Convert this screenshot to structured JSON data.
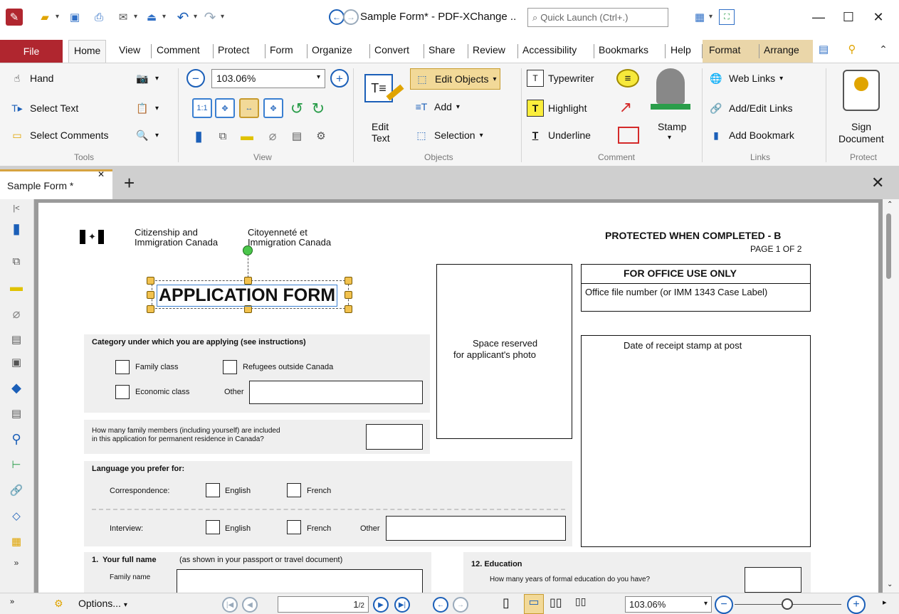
{
  "app": {
    "title": "Sample Form* - PDF-XChange ..",
    "quick_launch_placeholder": "Quick Launch (Ctrl+.)"
  },
  "ribbon_tabs": [
    "File",
    "Home",
    "View",
    "Comment",
    "Protect",
    "Form",
    "Organize",
    "Convert",
    "Share",
    "Review",
    "Accessibility",
    "Bookmarks",
    "Help",
    "Format",
    "Arrange"
  ],
  "tools": {
    "hand": "Hand",
    "select_text": "Select Text",
    "select_comments": "Select Comments",
    "label": "Tools"
  },
  "view": {
    "zoom": "103.06%",
    "label": "View"
  },
  "objects": {
    "edit_text_1": "Edit",
    "edit_text_2": "Text",
    "edit_objects": "Edit Objects",
    "add": "Add",
    "selection": "Selection",
    "label": "Objects"
  },
  "comment": {
    "typewriter": "Typewriter",
    "highlight": "Highlight",
    "underline": "Underline",
    "stamp": "Stamp",
    "label": "Comment"
  },
  "links": {
    "web_links": "Web Links",
    "add_edit_links": "Add/Edit Links",
    "add_bookmark": "Add Bookmark",
    "label": "Links"
  },
  "protect": {
    "sign_1": "Sign",
    "sign_2": "Document",
    "label": "Protect"
  },
  "doc_tab": {
    "name": "Sample Form *"
  },
  "form": {
    "dept_en_1": "Citizenship and",
    "dept_en_2": "Immigration Canada",
    "dept_fr_1": "Citoyenneté et",
    "dept_fr_2": "Immigration Canada",
    "protected": "PROTECTED WHEN COMPLETED - B",
    "page": "PAGE 1 OF 2",
    "title": "APPLICATION FORM",
    "photo_1": "Space reserved",
    "photo_2": "for applicant's photo",
    "office_use": "FOR OFFICE USE ONLY",
    "office_file": "Office file number (or IMM 1343 Case Label)",
    "receipt": "Date of receipt stamp at post",
    "category_heading": "Category under which you are applying (see instructions)",
    "family_class": "Family class",
    "refugees": "Refugees outside Canada",
    "economic_class": "Economic class",
    "other": "Other",
    "family_members_1": "How many family members (including yourself) are included",
    "family_members_2": "in this application for permanent residence in Canada?",
    "language_heading": "Language you prefer for:",
    "correspondence": "Correspondence:",
    "interview": "Interview:",
    "english": "English",
    "french": "French",
    "q1_num": "1.",
    "q1_bold": "Your full name",
    "q1_rest": "(as shown in your passport or travel document)",
    "family_name": "Family name",
    "q12": "12.  Education",
    "q12_sub": "How many years of formal education do you have?"
  },
  "status": {
    "options": "Options...",
    "page_current": "1",
    "page_total": "/2",
    "zoom": "103.06%"
  }
}
